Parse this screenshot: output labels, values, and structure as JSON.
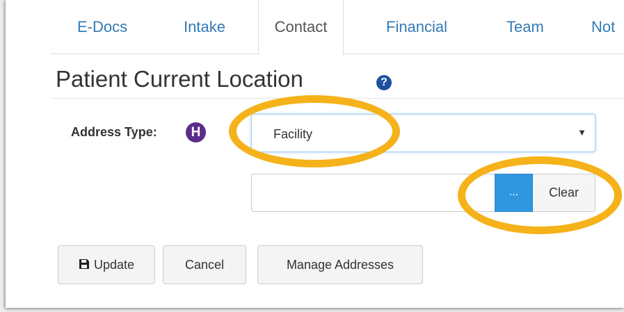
{
  "tabs": [
    {
      "label": "E-Docs",
      "active": false
    },
    {
      "label": "Intake",
      "active": false
    },
    {
      "label": "Contact",
      "active": true
    },
    {
      "label": "Financial",
      "active": false
    },
    {
      "label": "Team",
      "active": false
    },
    {
      "label": "Not",
      "active": false
    }
  ],
  "section": {
    "title": "Patient Current Location",
    "help_icon": "?"
  },
  "address_type": {
    "label": "Address Type:",
    "badge": "H",
    "selected_value": "Facility",
    "caret": "▼"
  },
  "location": {
    "value": "",
    "browse_label": "...",
    "clear_label": "Clear"
  },
  "actions": {
    "update_label": "Update",
    "cancel_label": "Cancel",
    "manage_label": "Manage Addresses"
  },
  "colors": {
    "link": "#337ab7",
    "primary_button": "#2f96e0",
    "badge": "#5b2c8a",
    "help_icon": "#1e4fa0",
    "highlight": "#f6b21b"
  }
}
